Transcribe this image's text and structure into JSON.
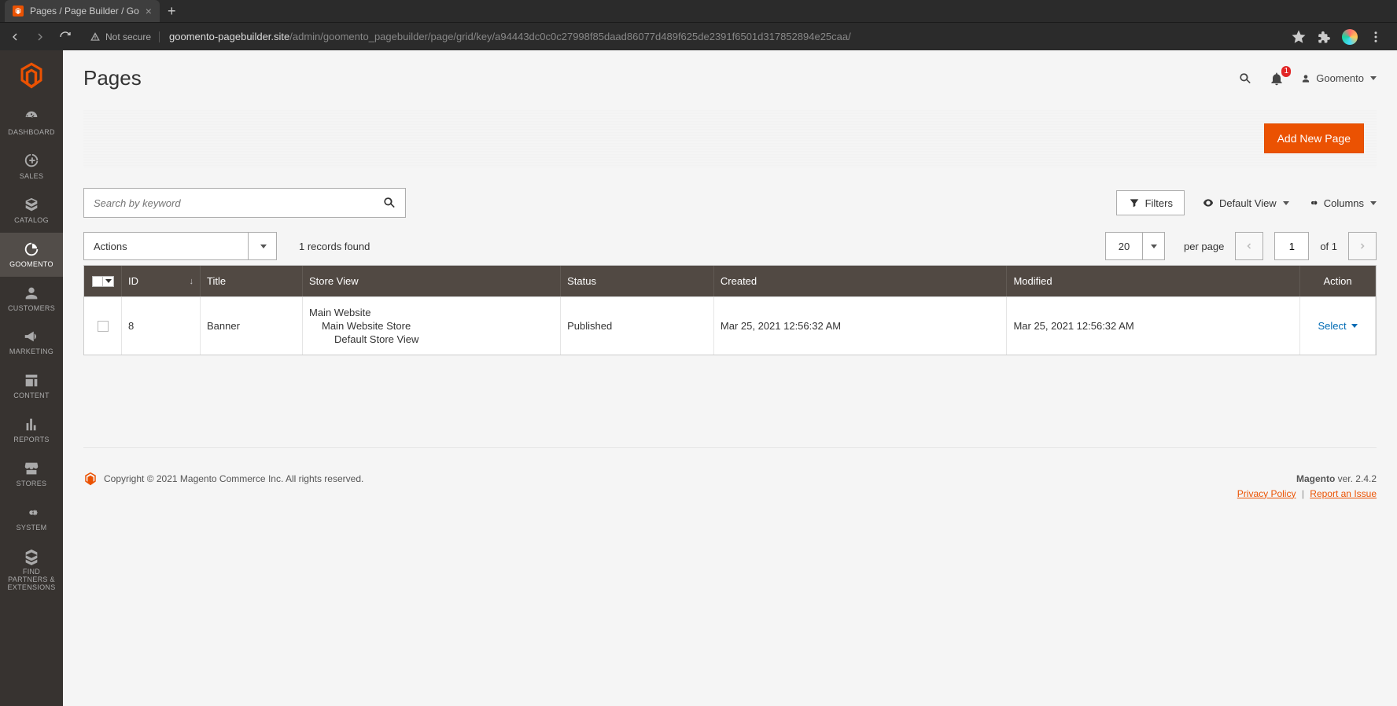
{
  "browser": {
    "tab_title": "Pages / Page Builder / Go",
    "url_host": "goomento-pagebuilder.site",
    "url_path": "/admin/goomento_pagebuilder/page/grid/key/a94443dc0c0c27998f85daad86077d489f625de2391f6501d317852894e25caa/",
    "not_secure": "Not secure"
  },
  "sidebar": {
    "items": [
      {
        "label": "DASHBOARD",
        "icon": "dashboard"
      },
      {
        "label": "SALES",
        "icon": "sales"
      },
      {
        "label": "CATALOG",
        "icon": "catalog"
      },
      {
        "label": "GOOMENTO",
        "icon": "goomento"
      },
      {
        "label": "CUSTOMERS",
        "icon": "customers"
      },
      {
        "label": "MARKETING",
        "icon": "marketing"
      },
      {
        "label": "CONTENT",
        "icon": "content"
      },
      {
        "label": "REPORTS",
        "icon": "reports"
      },
      {
        "label": "STORES",
        "icon": "stores"
      },
      {
        "label": "SYSTEM",
        "icon": "system"
      },
      {
        "label": "FIND PARTNERS & EXTENSIONS",
        "icon": "partners"
      }
    ]
  },
  "header": {
    "title": "Pages",
    "user": "Goomento",
    "notif_count": "1"
  },
  "toolbar": {
    "add_new": "Add New Page",
    "search_placeholder": "Search by keyword",
    "filters": "Filters",
    "default_view": "Default View",
    "columns": "Columns",
    "actions": "Actions",
    "records_found": "1 records found",
    "per_page_value": "20",
    "per_page_label": "per page",
    "page_current": "1",
    "page_total": "of 1"
  },
  "grid": {
    "headers": {
      "id": "ID",
      "title": "Title",
      "store": "Store View",
      "status": "Status",
      "created": "Created",
      "modified": "Modified",
      "action": "Action"
    },
    "rows": [
      {
        "id": "8",
        "title": "Banner",
        "store": [
          "Main Website",
          "Main Website Store",
          "Default Store View"
        ],
        "status": "Published",
        "created": "Mar 25, 2021 12:56:32 AM",
        "modified": "Mar 25, 2021 12:56:32 AM",
        "action": "Select"
      }
    ]
  },
  "footer": {
    "copyright": "Copyright © 2021 Magento Commerce Inc. All rights reserved.",
    "product": "Magento",
    "version": " ver. 2.4.2",
    "privacy": "Privacy Policy",
    "report": "Report an Issue"
  }
}
